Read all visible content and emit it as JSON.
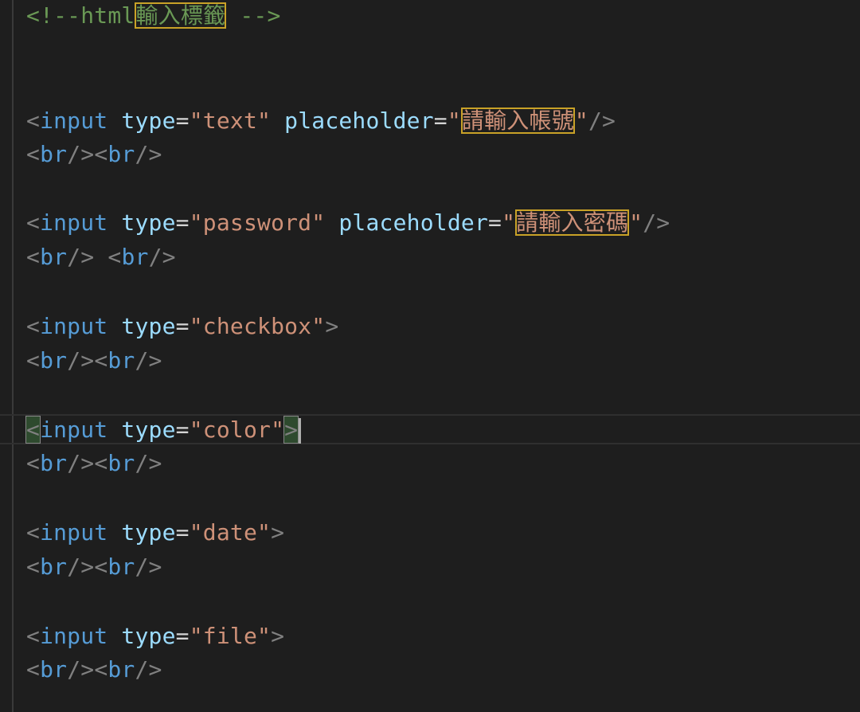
{
  "editor": {
    "lines": [
      {
        "comment_open": "<!--html",
        "comment_hl": "輸入標籤",
        "comment_close": " -->"
      },
      {
        "open": "<",
        "tag": "input",
        "attr": "type",
        "eq": "=",
        "q": "\"",
        "val": "text",
        "attr2": "placeholder",
        "val2": "請輸入帳號",
        "close": "/>"
      },
      {
        "br1_open": "<",
        "br1_tag": "br",
        "br1_close": "/>",
        "br2_open": "<",
        "br2_tag": "br",
        "br2_close": "/>"
      },
      {
        "open": "<",
        "tag": "input",
        "attr": "type",
        "eq": "=",
        "q": "\"",
        "val": "password",
        "attr2": "placeholder",
        "val2": "請輸入密碼",
        "close": "/>"
      },
      {
        "br1_open": "<",
        "br1_tag": "br",
        "br1_close": "/> ",
        "br2_open": "<",
        "br2_tag": "br",
        "br2_close": "/>"
      },
      {
        "open": "<",
        "tag": "input",
        "attr": "type",
        "eq": "=",
        "q": "\"",
        "val": "checkbox",
        "close": ">"
      },
      {
        "br1_open": "<",
        "br1_tag": "br",
        "br1_close": "/>",
        "br2_open": "<",
        "br2_tag": "br",
        "br2_close": "/>"
      },
      {
        "open": "<",
        "tag": "input",
        "attr": "type",
        "eq": "=",
        "q": "\"",
        "val": "color",
        "close": ">"
      },
      {
        "br1_open": "<",
        "br1_tag": "br",
        "br1_close": "/>",
        "br2_open": "<",
        "br2_tag": "br",
        "br2_close": "/>"
      },
      {
        "open": "<",
        "tag": "input",
        "attr": "type",
        "eq": "=",
        "q": "\"",
        "val": "date",
        "close": ">"
      },
      {
        "br1_open": "<",
        "br1_tag": "br",
        "br1_close": "/>",
        "br2_open": "<",
        "br2_tag": "br",
        "br2_close": "/>"
      },
      {
        "open": "<",
        "tag": "input",
        "attr": "type",
        "eq": "=",
        "q": "\"",
        "val": "file",
        "close": ">"
      },
      {
        "br1_open": "<",
        "br1_tag": "br",
        "br1_close": "/>",
        "br2_open": "<",
        "br2_tag": "br",
        "br2_close": "/>"
      }
    ]
  }
}
